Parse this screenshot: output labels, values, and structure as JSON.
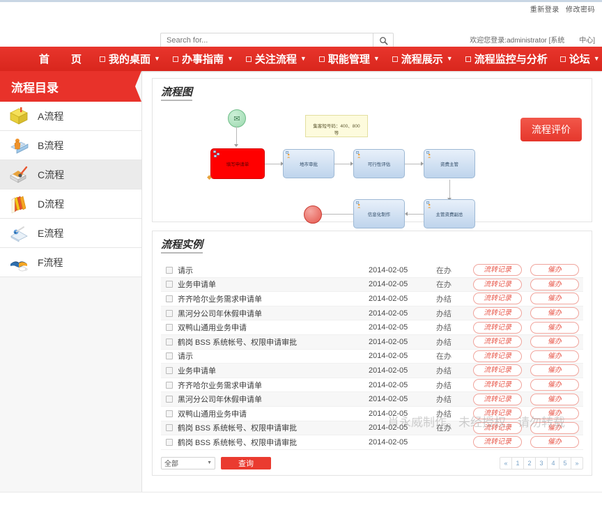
{
  "topbar": {
    "relogin": "重新登录",
    "change_password": "修改密码"
  },
  "search": {
    "placeholder": "Search for...",
    "value": "",
    "icon": "search-icon"
  },
  "welcome": {
    "text": "欢迎您登录:administrator [系统",
    "center": "中心]"
  },
  "nav": {
    "items": [
      {
        "label": "首　页",
        "square": false,
        "caret": false
      },
      {
        "label": "我的桌面",
        "square": true,
        "caret": true
      },
      {
        "label": "办事指南",
        "square": true,
        "caret": true
      },
      {
        "label": "关注流程",
        "square": true,
        "caret": true
      },
      {
        "label": "职能管理",
        "square": true,
        "caret": true
      },
      {
        "label": "流程展示",
        "square": true,
        "caret": true
      },
      {
        "label": "流程监控与分析",
        "square": true,
        "caret": false
      },
      {
        "label": "论坛",
        "square": true,
        "caret": true
      }
    ],
    "star_icon": "star-icon"
  },
  "sidebar": {
    "title": "流程目录",
    "items": [
      {
        "label": "A流程",
        "icon": "yellow-box-icon",
        "active": false
      },
      {
        "label": "B流程",
        "icon": "person-book-icon",
        "active": false
      },
      {
        "label": "C流程",
        "icon": "envelope-pen-icon",
        "active": true
      },
      {
        "label": "D流程",
        "icon": "books-stack-icon",
        "active": false
      },
      {
        "label": "E流程",
        "icon": "book-pen-icon",
        "active": false
      },
      {
        "label": "F流程",
        "icon": "open-book-cup-icon",
        "active": false
      }
    ]
  },
  "diagram": {
    "title": "流程图",
    "eval_button": "流程评价",
    "note": "集客短号码：400、800等",
    "start_icon": "envelope-icon",
    "nodes": [
      {
        "label": "填写申请单",
        "type": "start-active"
      },
      {
        "label": "地市审批",
        "type": "task"
      },
      {
        "label": "可行性评估",
        "type": "task"
      },
      {
        "label": "资费主管",
        "type": "task"
      },
      {
        "label": "信息化制作",
        "type": "task"
      },
      {
        "label": "主管资费副总",
        "type": "task"
      }
    ]
  },
  "instances": {
    "title": "流程实例",
    "rows": [
      {
        "name": "请示",
        "date": "2014-02-05",
        "status": "在办"
      },
      {
        "name": "业务申请单",
        "date": "2014-02-05",
        "status": "在办"
      },
      {
        "name": "齐齐哈尔业务需求申请单",
        "date": "2014-02-05",
        "status": "办结"
      },
      {
        "name": "黑河分公司年休假申请单",
        "date": "2014-02-05",
        "status": "办结"
      },
      {
        "name": "双鸭山通用业务申请",
        "date": "2014-02-05",
        "status": "办结"
      },
      {
        "name": "鹤岗 BSS 系统帐号、权限申请审批",
        "date": "2014-02-05",
        "status": "办结"
      },
      {
        "name": "请示",
        "date": "2014-02-05",
        "status": "在办"
      },
      {
        "name": "业务申请单",
        "date": "2014-02-05",
        "status": "办结"
      },
      {
        "name": "齐齐哈尔业务需求申请单",
        "date": "2014-02-05",
        "status": "办结"
      },
      {
        "name": "黑河分公司年休假申请单",
        "date": "2014-02-05",
        "status": "办结"
      },
      {
        "name": "双鸭山通用业务申请",
        "date": "2014-02-05",
        "status": "办结"
      },
      {
        "name": "鹤岗 BSS 系统帐号、权限申请审批",
        "date": "2014-02-05",
        "status": "在办"
      },
      {
        "name": "鹤岗 BSS 系统帐号、权限申请审批",
        "date": "2014-02-05",
        "status": ""
      }
    ],
    "action_record": "流转记录",
    "action_urge": "催办",
    "filter_value": "全部",
    "query_button": "查询",
    "pager": [
      "«",
      "1",
      "2",
      "3",
      "4",
      "5",
      "»"
    ]
  },
  "watermark": "肖永威制作。未经授权，请勿转载"
}
